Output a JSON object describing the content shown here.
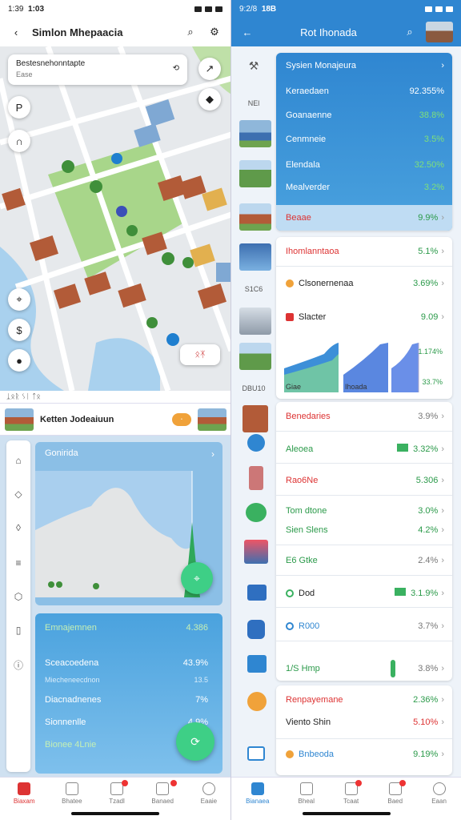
{
  "left": {
    "status": {
      "time": "1:39",
      "time2": "1:03"
    },
    "title": "Simlon Mhepaacia",
    "map_card": {
      "line1": "Bestesnehonntapte",
      "line2": "Ease"
    },
    "map_chip": "ᛟᛡ",
    "info_bar": "ᛣᛟᚱ ᛊᛁ ᛏᛟ",
    "location": {
      "name": "Ketten Jodeaiuun",
      "pill": "᛫"
    },
    "chart": {
      "title": "Gonirida"
    },
    "stats": [
      {
        "label": "Emnajemnen",
        "value": "4.386"
      },
      {
        "label": "Sceacoedena",
        "value": "43.9%"
      },
      {
        "label": "Miecheneecdnon",
        "value": "13.5",
        "small": true
      },
      {
        "label": "Diacnadnenes",
        "value": "7%"
      },
      {
        "label": "Sionnenlle",
        "value": "4.9%"
      },
      {
        "label": "Bionee 4Lnie",
        "value": ""
      }
    ],
    "nav": [
      "Biaxam",
      "Bhatee",
      "Tzadl",
      "Banaed",
      "Eaaie"
    ]
  },
  "right": {
    "status": {
      "time": "9:2/8",
      "time2": "18B"
    },
    "title": "Rot Ihonada",
    "thumb_labels": [
      "NEl",
      "S1C6",
      "DBU10"
    ],
    "top_card": {
      "title": "Sysien Monajeura",
      "rows": [
        {
          "label": "Keraedaen",
          "value": "92.355%"
        },
        {
          "label": "Goanaenne",
          "value": "38.8%"
        },
        {
          "label": "Cenmneie",
          "value": "3.5%"
        },
        {
          "label": "Elendala",
          "value": "32.50%"
        },
        {
          "label": "Mealverder",
          "value": "3.2%"
        },
        {
          "label": "Beaae",
          "value": "9.9%"
        }
      ]
    },
    "mid_card": {
      "title": "Ihomlanntaoa",
      "title_value": "5.1%",
      "rows": [
        {
          "label": "Clsonernenaa",
          "value": "3.69%"
        },
        {
          "label": "Slacter",
          "value": "9.09"
        }
      ],
      "chart_labels": {
        "a": "Giae",
        "b": "Ihoada",
        "c1": "1.174%",
        "c2": "33.7%"
      }
    },
    "list_card": {
      "title": "Benedaries",
      "title_value": "3.9%",
      "rows": [
        {
          "label": "Aleoea",
          "value": "3.32%"
        },
        {
          "label": "Rao6Ne",
          "value": "5.306"
        },
        {
          "label": "Tom dtone",
          "value": "3.0%"
        },
        {
          "label": "Sien Slens",
          "value": "4.2%"
        },
        {
          "label": "E6 Gtke",
          "value": "2.4%"
        },
        {
          "label": "Dod",
          "value": "3.1.9%"
        },
        {
          "label": "R000",
          "value": "3.7%"
        },
        {
          "label": "1/S Hmp",
          "value": "3.8%"
        }
      ]
    },
    "bottom_card": {
      "rows": [
        {
          "label": "Renpayemane",
          "value": "2.36%"
        },
        {
          "label": "Viento Shin",
          "value": "5.10%"
        },
        {
          "label": "Bnbeoda",
          "value": "9.19%"
        }
      ]
    },
    "nav": [
      "Bianaea",
      "Bheal",
      "Tcaat",
      "Baed",
      "Eaan"
    ]
  }
}
